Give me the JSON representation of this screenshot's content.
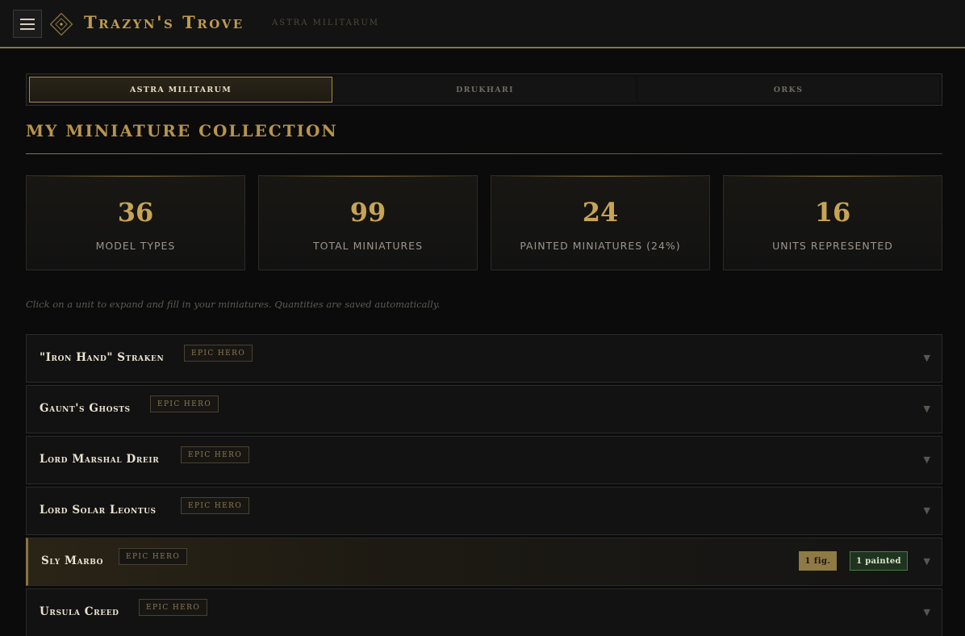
{
  "header": {
    "brand": "Trazyn's Trove",
    "subtitle": "ASTRA MILITARUM",
    "accent": "#bf9b4c"
  },
  "tabs": [
    {
      "label": "ASTRA MILITARUM",
      "active": true
    },
    {
      "label": "DRUKHARI",
      "active": false
    },
    {
      "label": "ORKS",
      "active": false
    }
  ],
  "page": {
    "title": "MY MINIATURE COLLECTION",
    "hint": "Click on a unit to expand and fill in your miniatures. Quantities are saved automatically."
  },
  "stats": [
    {
      "value": "36",
      "label": "MODEL TYPES"
    },
    {
      "value": "99",
      "label": "TOTAL MINIATURES"
    },
    {
      "value": "24",
      "label": "PAINTED MINIATURES (24%)"
    },
    {
      "value": "16",
      "label": "UNITS REPRESENTED"
    }
  ],
  "units": [
    {
      "name": "\"Iron Hand\" Straken",
      "badge": "EPIC HERO"
    },
    {
      "name": "Gaunt's Ghosts",
      "badge": "EPIC HERO"
    },
    {
      "name": "Lord Marshal Dreir",
      "badge": "EPIC HERO"
    },
    {
      "name": "Lord Solar Leontus",
      "badge": "EPIC HERO"
    },
    {
      "name": "Sly Marbo",
      "badge": "EPIC HERO",
      "figs": "1 fig.",
      "painted": "1 painted"
    },
    {
      "name": "Ursula Creed",
      "badge": "EPIC HERO"
    }
  ],
  "icons": {
    "menu": "hamburger-icon",
    "logo": "diamond-emblem-icon",
    "expand": "chevron-down-icon"
  }
}
